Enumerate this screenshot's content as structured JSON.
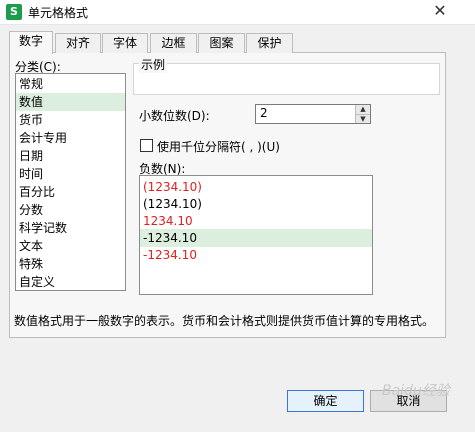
{
  "window": {
    "app_icon": "S",
    "title": "单元格格式",
    "close": "✕"
  },
  "tabs": [
    {
      "label": "数字",
      "active": true
    },
    {
      "label": "对齐"
    },
    {
      "label": "字体"
    },
    {
      "label": "边框"
    },
    {
      "label": "图案"
    },
    {
      "label": "保护"
    }
  ],
  "category": {
    "label": "分类(C):",
    "items": [
      "常规",
      "数值",
      "货币",
      "会计专用",
      "日期",
      "时间",
      "百分比",
      "分数",
      "科学记数",
      "文本",
      "特殊",
      "自定义"
    ],
    "selected": "数值"
  },
  "example": {
    "label": "示例",
    "value": ""
  },
  "decimals": {
    "label": "小数位数(D):",
    "value": "2"
  },
  "thousands": {
    "label": "使用千位分隔符( , )(U)",
    "checked": false
  },
  "negative": {
    "label": "负数(N):",
    "options": [
      {
        "text": "(1234.10)",
        "color": "#e02020"
      },
      {
        "text": "(1234.10)",
        "color": "#000000"
      },
      {
        "text": "1234.10",
        "color": "#e02020"
      },
      {
        "text": "-1234.10",
        "color": "#000000",
        "selected": true
      },
      {
        "text": "-1234.10",
        "color": "#e02020"
      }
    ]
  },
  "description": "数值格式用于一般数字的表示。货币和会计格式则提供货币值计算的专用格式。",
  "buttons": {
    "ok": "确定",
    "cancel": "取消"
  },
  "watermark": "Baidu经验",
  "colors": {
    "selection": "#dceedd",
    "negative_red": "#e02020",
    "app_icon": "#1c9c4c"
  }
}
